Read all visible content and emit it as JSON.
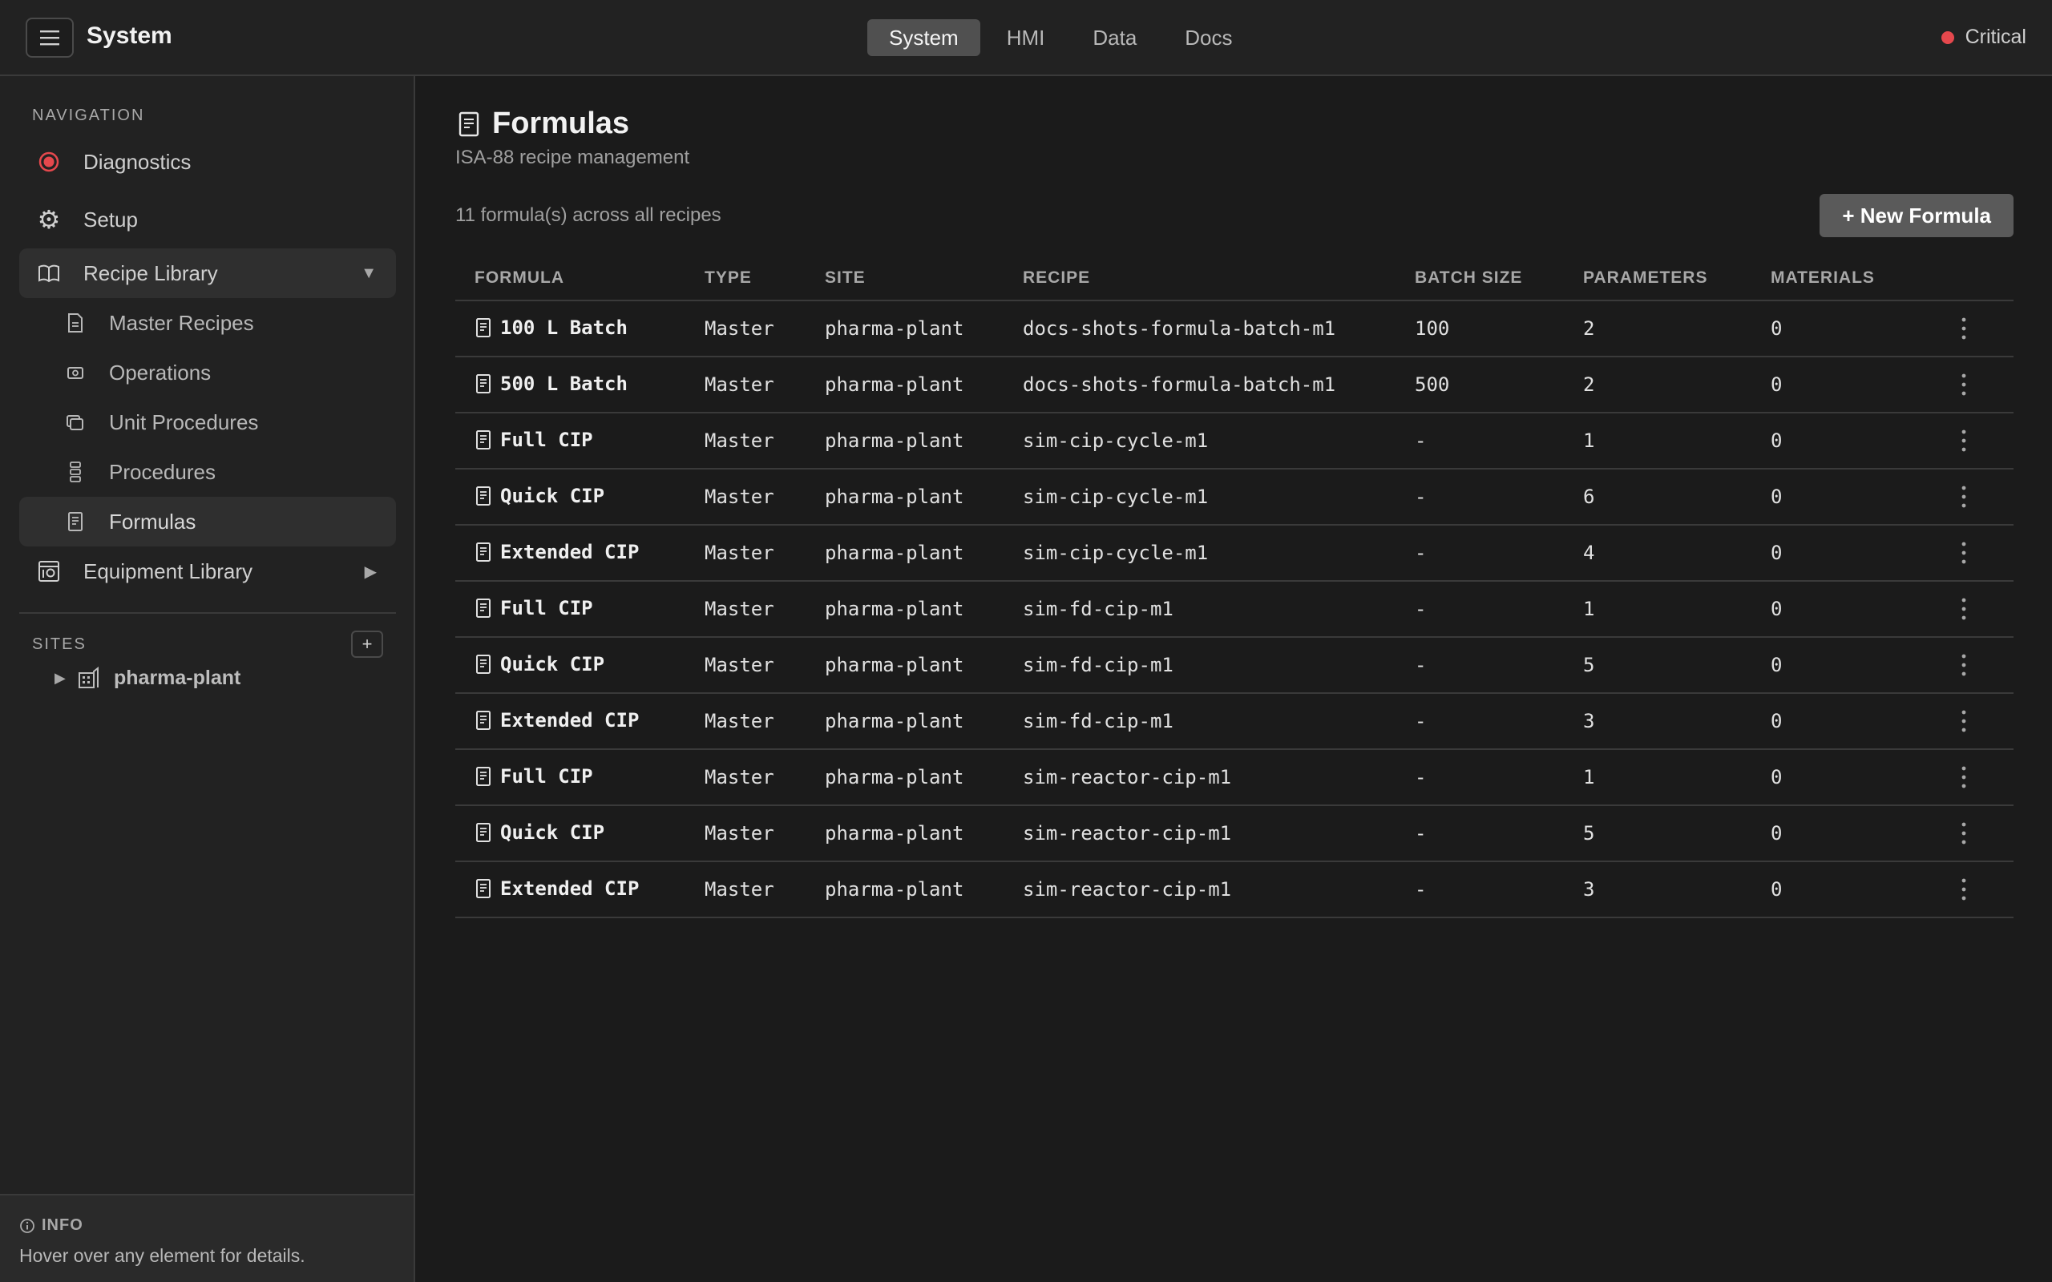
{
  "app": {
    "title": "System"
  },
  "tabs": [
    {
      "label": "System",
      "active": true
    },
    {
      "label": "HMI",
      "active": false
    },
    {
      "label": "Data",
      "active": false
    },
    {
      "label": "Docs",
      "active": false
    }
  ],
  "status": {
    "label": "Critical",
    "color": "#e5484d"
  },
  "sidebar": {
    "nav_label": "NAVIGATION",
    "items": [
      {
        "label": "Diagnostics",
        "icon": "record-icon"
      },
      {
        "label": "Setup",
        "icon": "gear-icon"
      },
      {
        "label": "Recipe Library",
        "icon": "book-icon",
        "expanded": true,
        "chevron": "▼"
      },
      {
        "label": "Equipment Library",
        "icon": "equipment-icon",
        "expanded": false,
        "chevron": "▶"
      }
    ],
    "sub_items": [
      {
        "label": "Master Recipes",
        "icon": "document-icon"
      },
      {
        "label": "Operations",
        "icon": "operation-icon"
      },
      {
        "label": "Unit Procedures",
        "icon": "layers-icon"
      },
      {
        "label": "Procedures",
        "icon": "steps-icon"
      },
      {
        "label": "Formulas",
        "icon": "formula-icon",
        "active": true
      }
    ],
    "sites_label": "SITES",
    "add_label": "+",
    "sites": [
      {
        "name": "pharma-plant",
        "arrow": "▶"
      }
    ]
  },
  "info": {
    "title": "INFO",
    "text": "Hover over any element for details."
  },
  "main": {
    "title": "Formulas",
    "subtitle": "ISA-88 recipe management",
    "count_text": "11 formula(s) across all recipes",
    "new_button": "+ New Formula"
  },
  "table": {
    "columns": [
      "FORMULA",
      "TYPE",
      "SITE",
      "RECIPE",
      "BATCH SIZE",
      "PARAMETERS",
      "MATERIALS"
    ],
    "rows": [
      {
        "formula": "100 L Batch",
        "type": "Master",
        "site": "pharma-plant",
        "recipe": "docs-shots-formula-batch-m1",
        "batch_size": "100",
        "parameters": "2",
        "materials": "0"
      },
      {
        "formula": "500 L Batch",
        "type": "Master",
        "site": "pharma-plant",
        "recipe": "docs-shots-formula-batch-m1",
        "batch_size": "500",
        "parameters": "2",
        "materials": "0"
      },
      {
        "formula": "Full CIP",
        "type": "Master",
        "site": "pharma-plant",
        "recipe": "sim-cip-cycle-m1",
        "batch_size": "-",
        "parameters": "1",
        "materials": "0"
      },
      {
        "formula": "Quick CIP",
        "type": "Master",
        "site": "pharma-plant",
        "recipe": "sim-cip-cycle-m1",
        "batch_size": "-",
        "parameters": "6",
        "materials": "0"
      },
      {
        "formula": "Extended CIP",
        "type": "Master",
        "site": "pharma-plant",
        "recipe": "sim-cip-cycle-m1",
        "batch_size": "-",
        "parameters": "4",
        "materials": "0"
      },
      {
        "formula": "Full CIP",
        "type": "Master",
        "site": "pharma-plant",
        "recipe": "sim-fd-cip-m1",
        "batch_size": "-",
        "parameters": "1",
        "materials": "0"
      },
      {
        "formula": "Quick CIP",
        "type": "Master",
        "site": "pharma-plant",
        "recipe": "sim-fd-cip-m1",
        "batch_size": "-",
        "parameters": "5",
        "materials": "0"
      },
      {
        "formula": "Extended CIP",
        "type": "Master",
        "site": "pharma-plant",
        "recipe": "sim-fd-cip-m1",
        "batch_size": "-",
        "parameters": "3",
        "materials": "0"
      },
      {
        "formula": "Full CIP",
        "type": "Master",
        "site": "pharma-plant",
        "recipe": "sim-reactor-cip-m1",
        "batch_size": "-",
        "parameters": "1",
        "materials": "0"
      },
      {
        "formula": "Quick CIP",
        "type": "Master",
        "site": "pharma-plant",
        "recipe": "sim-reactor-cip-m1",
        "batch_size": "-",
        "parameters": "5",
        "materials": "0"
      },
      {
        "formula": "Extended CIP",
        "type": "Master",
        "site": "pharma-plant",
        "recipe": "sim-reactor-cip-m1",
        "batch_size": "-",
        "parameters": "3",
        "materials": "0"
      }
    ]
  }
}
